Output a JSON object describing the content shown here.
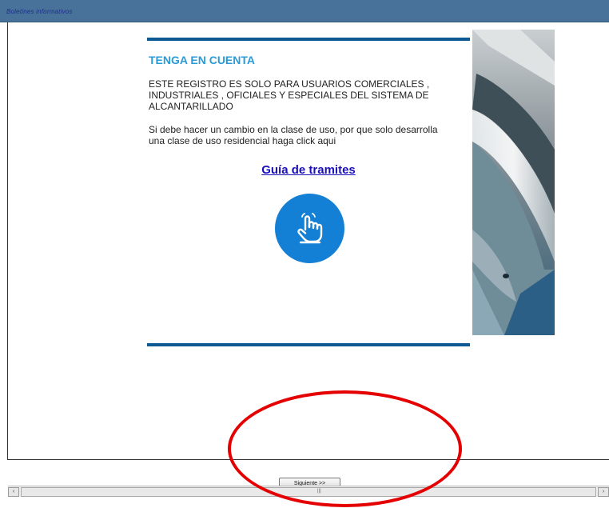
{
  "header": {
    "title": "Boletines informativos"
  },
  "notice": {
    "heading": "TENGA EN CUENTA",
    "body": "ESTE REGISTRO ES SOLO PARA USUARIOS COMERCIALES , INDUSTRIALES , OFICIALES Y ESPECIALES DEL SISTEMA DE ALCANTARILLADO",
    "instruction": "Si debe hacer un cambio en la clase de uso, por que solo desarrolla una clase de uso residencial haga click aqui",
    "link_label": "Guía de tramites",
    "hand_icon": "hand-pointer-icon"
  },
  "footer": {
    "next_label": "Siguiente >>"
  },
  "scrollbar": {
    "left_arrow": "‹",
    "right_arrow": "›",
    "grip": "|||"
  },
  "colors": {
    "topbar": "#48729a",
    "accent": "#0b5a93",
    "heading": "#2b9ad8",
    "link": "#1a0fb8",
    "hand_button": "#1480d5",
    "annotation": "#e40000"
  }
}
